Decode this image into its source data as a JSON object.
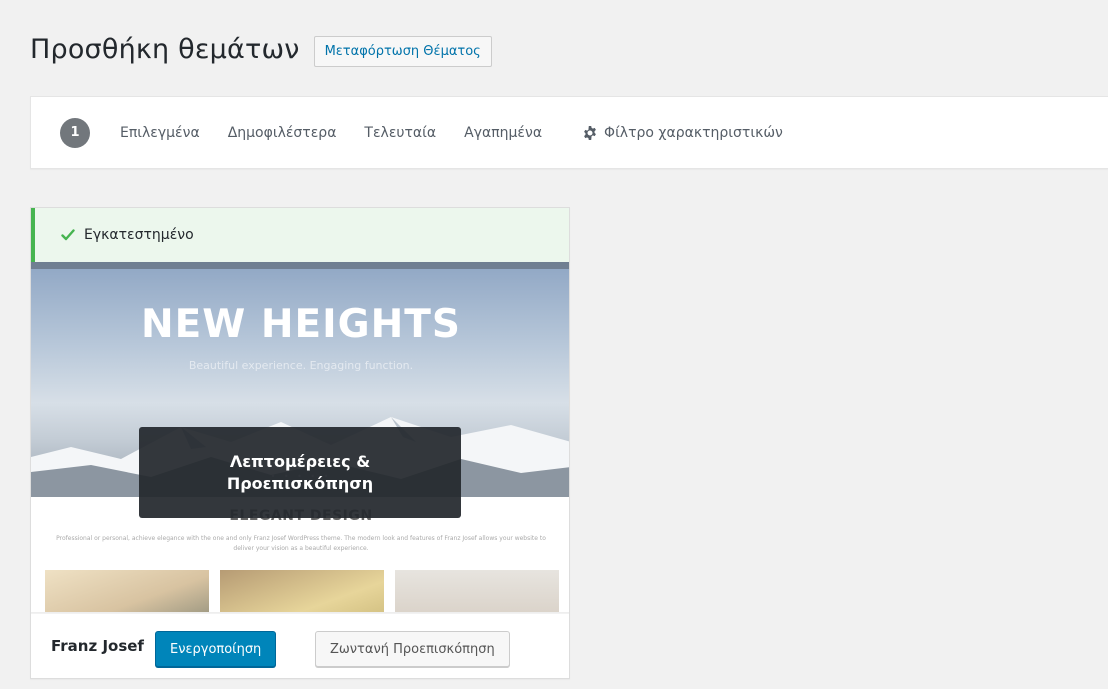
{
  "header": {
    "title": "Προσθήκη θεμάτων",
    "upload_label": "Μεταφόρτωση Θέματος"
  },
  "filters": {
    "count": "1",
    "links": [
      "Επιλεγμένα",
      "Δημοφιλέστερα",
      "Τελευταία",
      "Αγαπημένα"
    ],
    "feature_filter_label": "Φίλτρο χαρακτηριστικών",
    "feature_filter_icon": "gear-icon"
  },
  "theme": {
    "installed_label": "Εγκατεστημένο",
    "installed_icon": "check-icon",
    "name": "Franz Josef",
    "details_label": "Λεπτομέρειες & Προεπισκόπηση",
    "activate_label": "Ενεργοποίηση",
    "live_preview_label": "Ζωντανή Προεπισκόπηση",
    "screenshot": {
      "hero_title": "NEW HEIGHTS",
      "hero_subtitle": "Beautiful experience. Engaging function.",
      "section_title": "ELEGANT DESIGN",
      "section_text": "Professional or personal, achieve elegance with the one and only Franz Josef WordPress theme. The modern look and features of Franz Josef allows your website to deliver your vision as a beautiful experience."
    }
  },
  "colors": {
    "primary_button": "#0085ba",
    "installed_border": "#46b450",
    "installed_bg": "#ecf7ed",
    "link": "#0073aa"
  }
}
